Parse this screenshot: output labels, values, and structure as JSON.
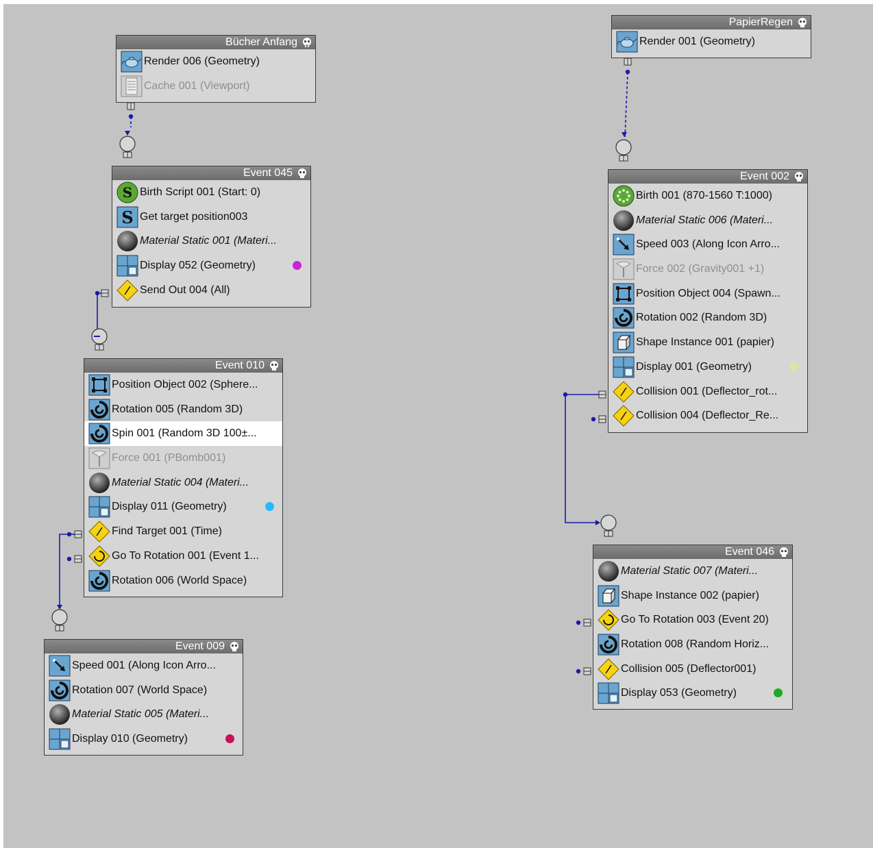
{
  "nodes": {
    "buecher": {
      "title": "Bücher Anfang",
      "ops": [
        {
          "label": "Render 006 (Geometry)"
        },
        {
          "label": "Cache 001 (Viewport)"
        }
      ]
    },
    "event045": {
      "title": "Event 045",
      "ops": [
        {
          "label": "Birth Script 001 (Start: 0)"
        },
        {
          "label": "Get target position003"
        },
        {
          "label": "Material Static 001 (Materi..."
        },
        {
          "label": "Display 052 (Geometry)"
        },
        {
          "label": "Send Out 004 (All)"
        }
      ]
    },
    "event010": {
      "title": "Event 010",
      "ops": [
        {
          "label": "Position Object 002 (Sphere..."
        },
        {
          "label": "Rotation 005 (Random 3D)"
        },
        {
          "label": "Spin 001 (Random 3D 100±..."
        },
        {
          "label": "Force 001 (PBomb001)"
        },
        {
          "label": "Material Static 004 (Materi..."
        },
        {
          "label": "Display 011 (Geometry)"
        },
        {
          "label": "Find Target 001 (Time)"
        },
        {
          "label": "Go To Rotation 001 (Event 1..."
        },
        {
          "label": "Rotation 006 (World Space)"
        }
      ]
    },
    "event009": {
      "title": "Event 009",
      "ops": [
        {
          "label": "Speed 001 (Along Icon Arro..."
        },
        {
          "label": "Rotation 007 (World Space)"
        },
        {
          "label": "Material Static 005 (Materi..."
        },
        {
          "label": "Display 010 (Geometry)"
        }
      ]
    },
    "papier": {
      "title": "PapierRegen",
      "ops": [
        {
          "label": "Render 001 (Geometry)"
        }
      ]
    },
    "event002": {
      "title": "Event 002",
      "ops": [
        {
          "label": "Birth 001 (870-1560 T:1000)"
        },
        {
          "label": "Material Static 006 (Materi..."
        },
        {
          "label": "Speed 003 (Along Icon Arro..."
        },
        {
          "label": "Force 002 (Gravity001 +1)"
        },
        {
          "label": "Position Object 004 (Spawn..."
        },
        {
          "label": "Rotation 002 (Random 3D)"
        },
        {
          "label": "Shape Instance 001 (papier)"
        },
        {
          "label": "Display 001 (Geometry)"
        },
        {
          "label": "Collision 001 (Deflector_rot..."
        },
        {
          "label": "Collision 004 (Deflector_Re..."
        }
      ]
    },
    "event046": {
      "title": "Event 046",
      "ops": [
        {
          "label": "Material Static 007 (Materi..."
        },
        {
          "label": "Shape Instance 002 (papier)"
        },
        {
          "label": "Go To Rotation 003 (Event 20)"
        },
        {
          "label": "Rotation 008 (Random Horiz..."
        },
        {
          "label": "Collision 005 (Deflector001)"
        },
        {
          "label": "Display 053 (Geometry)"
        }
      ]
    }
  },
  "colors": {
    "canvas": "#c3c3c3",
    "wire": "#1a1aa8",
    "display052": "#cc22dd",
    "display011": "#22bbff",
    "display010": "#c8115a",
    "display001": "#d8e6a0",
    "display053": "#22aa22"
  }
}
